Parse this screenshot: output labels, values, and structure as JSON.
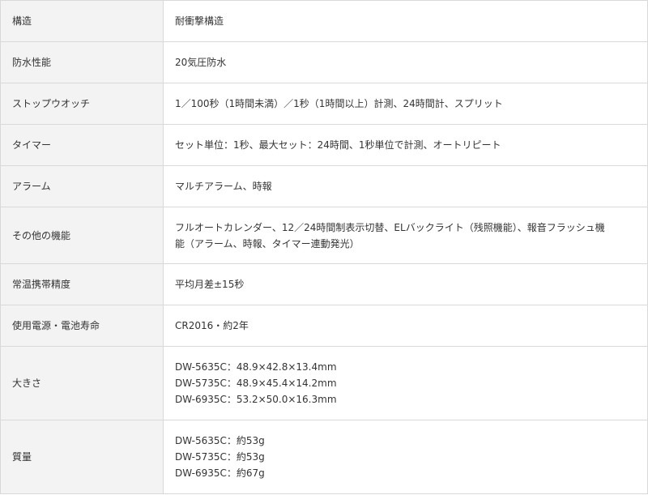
{
  "specs": [
    {
      "label": "構造",
      "lines": [
        "耐衝撃構造"
      ]
    },
    {
      "label": "防水性能",
      "lines": [
        "20気圧防水"
      ]
    },
    {
      "label": "ストップウオッチ",
      "lines": [
        "1／100秒（1時間未満）／1秒（1時間以上）計測、24時間計、スプリット"
      ]
    },
    {
      "label": "タイマー",
      "lines": [
        "セット単位：1秒、最大セット：24時間、1秒単位で計測、オートリピート"
      ]
    },
    {
      "label": "アラーム",
      "lines": [
        "マルチアラーム、時報"
      ]
    },
    {
      "label": "その他の機能",
      "lines": [
        "フルオートカレンダー、12／24時間制表示切替、ELバックライト（残照機能）、報音フラッシュ機",
        "能（アラーム、時報、タイマー連動発光）"
      ]
    },
    {
      "label": "常温携帯精度",
      "lines": [
        "平均月差±15秒"
      ]
    },
    {
      "label": "使用電源・電池寿命",
      "lines": [
        "CR2016・約2年"
      ]
    },
    {
      "label": "大きさ",
      "lines": [
        "DW-5635C：48.9×42.8×13.4mm",
        "DW-5735C：48.9×45.4×14.2mm",
        "DW-6935C：53.2×50.0×16.3mm"
      ]
    },
    {
      "label": "質量",
      "lines": [
        "DW-5635C：約53g",
        "DW-5735C：約53g",
        "DW-6935C：約67g"
      ]
    }
  ]
}
